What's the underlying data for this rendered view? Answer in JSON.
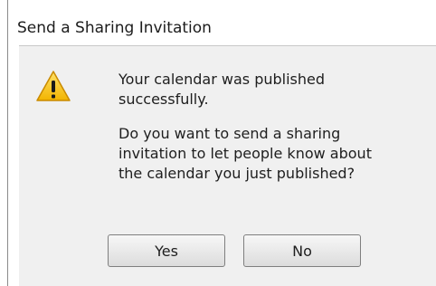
{
  "dialog": {
    "title": "Send a Sharing Invitation",
    "icon": "warning-icon",
    "message_lines_1": [
      "Your calendar was published",
      "successfully."
    ],
    "message_lines_2": [
      "Do you want to send a sharing",
      "invitation to let people know about",
      "the calendar you just published?"
    ]
  },
  "buttons": {
    "yes_label": "Yes",
    "no_label": "No"
  },
  "colors": {
    "warning_fill": "#f4c20d",
    "warning_outline": "#c98a00",
    "client_background": "#f0f0f0"
  }
}
